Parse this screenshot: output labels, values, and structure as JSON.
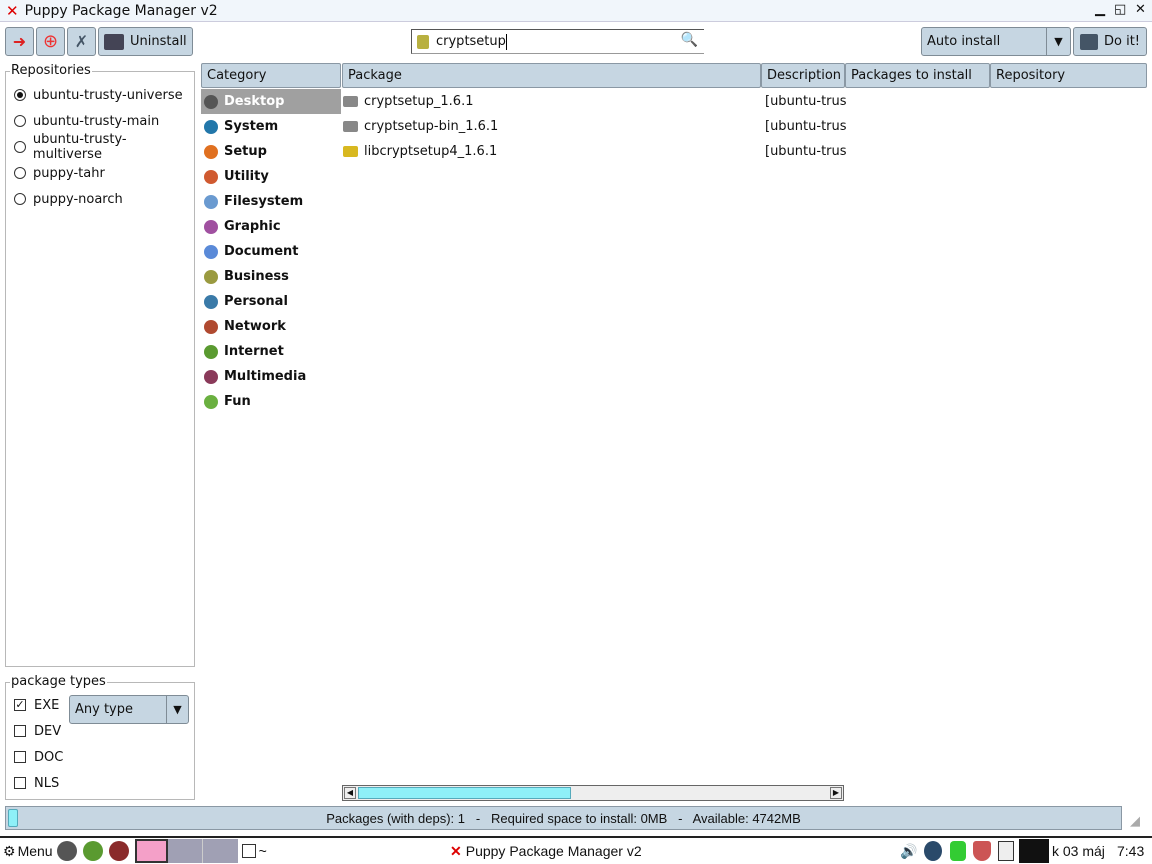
{
  "window": {
    "title": "Puppy Package Manager v2"
  },
  "toolbar": {
    "uninstall": "Uninstall",
    "search_value": "cryptsetup",
    "install_mode": "Auto install",
    "do_it": "Do it!"
  },
  "repositories": {
    "label": "Repositories",
    "items": [
      {
        "name": "ubuntu-trusty-universe",
        "selected": true
      },
      {
        "name": "ubuntu-trusty-main",
        "selected": false
      },
      {
        "name": "ubuntu-trusty-multiverse",
        "selected": false
      },
      {
        "name": "puppy-tahr",
        "selected": false
      },
      {
        "name": "puppy-noarch",
        "selected": false
      }
    ]
  },
  "columns": {
    "category": "Category",
    "package": "Package",
    "description": "Description",
    "to_install": "Packages to install",
    "repository": "Repository"
  },
  "categories": [
    {
      "label": "Desktop",
      "color": "#555555",
      "selected": true
    },
    {
      "label": "System",
      "color": "#2277aa"
    },
    {
      "label": "Setup",
      "color": "#e07020"
    },
    {
      "label": "Utility",
      "color": "#d05a30"
    },
    {
      "label": "Filesystem",
      "color": "#6a9ad0"
    },
    {
      "label": "Graphic",
      "color": "#a050a0"
    },
    {
      "label": "Document",
      "color": "#5a8ad8"
    },
    {
      "label": "Business",
      "color": "#9a9a40"
    },
    {
      "label": "Personal",
      "color": "#3a7aa8"
    },
    {
      "label": "Network",
      "color": "#b04a30"
    },
    {
      "label": "Internet",
      "color": "#5a9a30"
    },
    {
      "label": "Multimedia",
      "color": "#8a3a5a"
    },
    {
      "label": "Fun",
      "color": "#6ab040"
    }
  ],
  "packages": [
    {
      "name": "cryptsetup_1.6.1",
      "desc": "[ubuntu-trus",
      "icon": "drive-icon"
    },
    {
      "name": "cryptsetup-bin_1.6.1",
      "desc": "[ubuntu-trus",
      "icon": "drive-icon"
    },
    {
      "name": "libcryptsetup4_1.6.1",
      "desc": "[ubuntu-trus",
      "icon": "library-icon"
    }
  ],
  "package_types": {
    "label": "package types",
    "items": [
      {
        "label": "EXE",
        "checked": true
      },
      {
        "label": "DEV",
        "checked": false
      },
      {
        "label": "DOC",
        "checked": false
      },
      {
        "label": "NLS",
        "checked": false
      }
    ],
    "type_select": "Any type"
  },
  "status": {
    "text": "Packages (with deps): 1   -   Required space to install: 0MB   -   Available: 4742MB"
  },
  "taskbar": {
    "menu": "Menu",
    "terminal": "~",
    "window": "Puppy Package Manager v2",
    "date": "k 03 máj",
    "time": "7:43"
  }
}
